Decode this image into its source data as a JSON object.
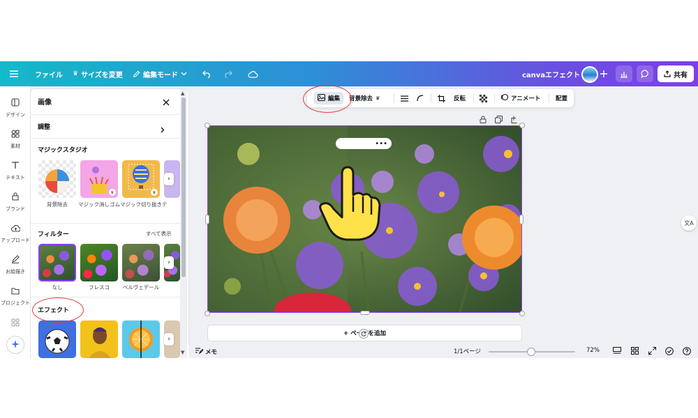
{
  "topbar": {
    "file_label": "ファイル",
    "resize_label": "サイズを変更",
    "edit_mode_label": "編集モード",
    "design_title": "canvaエフェクト",
    "share_label": "共有",
    "icons": [
      "menu-icon",
      "crown-icon",
      "pencil-icon",
      "chevron-down-icon",
      "undo-icon",
      "redo-icon",
      "cloud-icon",
      "add-icon",
      "chart-icon",
      "comment-icon",
      "share-icon"
    ]
  },
  "rail": {
    "items": [
      {
        "label": "デザイン",
        "icon": "design-icon"
      },
      {
        "label": "素材",
        "icon": "elements-icon"
      },
      {
        "label": "テキスト",
        "icon": "text-icon"
      },
      {
        "label": "ブランド",
        "icon": "brand-icon"
      },
      {
        "label": "アップロード",
        "icon": "upload-icon"
      },
      {
        "label": "お絵描き",
        "icon": "draw-icon"
      },
      {
        "label": "プロジェクト",
        "icon": "folder-icon"
      }
    ]
  },
  "panel": {
    "title": "画像",
    "adjust_label": "調整",
    "magic_studio_title": "マジックスタジオ",
    "magic_items": [
      {
        "label": "背景除去"
      },
      {
        "label": "マジック消しゴム"
      },
      {
        "label": "マジック切り抜き"
      },
      {
        "label": "テ"
      }
    ],
    "filters_title": "フィルター",
    "see_all_label": "すべて表示",
    "filters": [
      {
        "label": "なし"
      },
      {
        "label": "フレスコ"
      },
      {
        "label": "ベルヴェデール"
      }
    ],
    "effects_title": "エフェクト"
  },
  "context_toolbar": {
    "edit_label": "編集",
    "bg_remove_label": "背景除去",
    "flip_label": "反転",
    "animate_label": "アニメート",
    "position_label": "配置"
  },
  "canvas": {
    "add_page_label": "+ ページを追加"
  },
  "status": {
    "notes_label": "メモ",
    "page_indicator": "1/1ページ",
    "zoom_label": "72%",
    "zoom_value": 72
  },
  "colors": {
    "topbar_start": "#15b9c9",
    "topbar_end": "#7d3fe6",
    "selection": "#8b3dff",
    "highlight_ring": "#e23b3b"
  }
}
